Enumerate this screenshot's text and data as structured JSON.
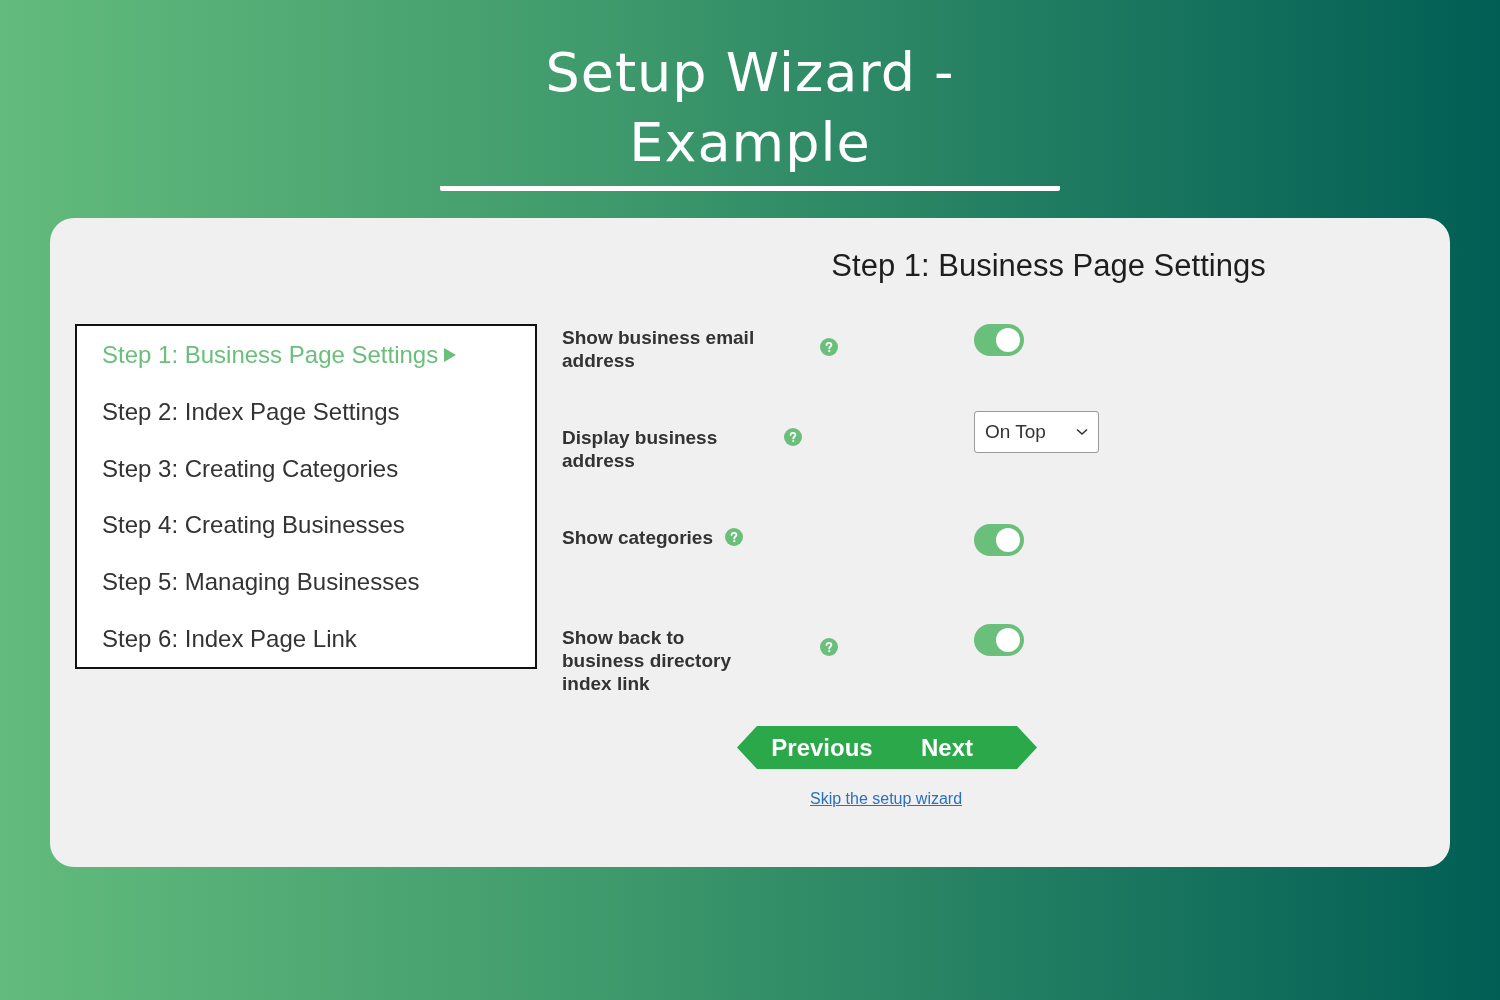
{
  "page_title": "Setup Wizard - Example",
  "steps": [
    {
      "label": "Step 1: Business Page Settings",
      "selected": true
    },
    {
      "label": "Step 2: Index Page Settings",
      "selected": false
    },
    {
      "label": "Step 3: Creating Categories",
      "selected": false
    },
    {
      "label": "Step 4: Creating Businesses",
      "selected": false
    },
    {
      "label": "Step 5: Managing Businesses",
      "selected": false
    },
    {
      "label": "Step 6: Index Page Link",
      "selected": false
    }
  ],
  "panel_title": "Step 1: Business Page Settings",
  "settings": [
    {
      "kind": "toggle",
      "label": "Show business email address",
      "on": true
    },
    {
      "kind": "select",
      "label": "Display business address",
      "value": "On Top"
    },
    {
      "kind": "toggle",
      "label": "Show categories",
      "on": true
    },
    {
      "kind": "toggle",
      "label": "Show back to business directory index link",
      "on": true
    }
  ],
  "buttons": {
    "previous": "Previous",
    "next": "Next"
  },
  "skip_link": "Skip the setup wizard"
}
